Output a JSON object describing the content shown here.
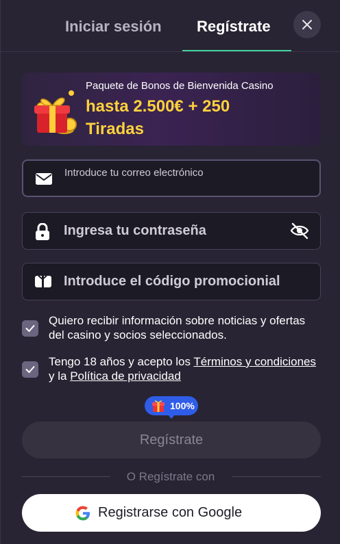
{
  "tabs": {
    "login_label": "Iniciar sesión",
    "register_label": "Regístrate"
  },
  "banner": {
    "subtitle": "Paquete de Bonos de Bienvenida Casino",
    "headline": "hasta 2.500€ + 250 Tiradas"
  },
  "form": {
    "email_placeholder": "Introduce tu correo electrónico",
    "password_placeholder": "Ingresa tu contraseña",
    "promo_placeholder": "Introduce el código promocionial"
  },
  "consents": {
    "marketing_text": "Quiero recibir información sobre noticias y ofertas del casino y socios seleccionados.",
    "marketing_checked": true,
    "age_prefix": "Tengo 18 años y acepto los ",
    "terms_link": "Términos y condiciones",
    "age_middle": " y la ",
    "privacy_link": "Política de privacidad",
    "age_checked": true
  },
  "badge": {
    "text": "100%"
  },
  "actions": {
    "submit_label": "Regístrate",
    "or_text": "O Regístrate con",
    "google_label": "Registrarse con Google"
  },
  "colors": {
    "accent_underline": "#3fd39a",
    "bonus_text": "#ffd23c",
    "badge_bg": "#2f5de8"
  },
  "icons": [
    "close-icon",
    "gift-icon",
    "mail-icon",
    "lock-icon",
    "eye-off-icon",
    "ticket-icon",
    "check-icon",
    "google-icon"
  ]
}
